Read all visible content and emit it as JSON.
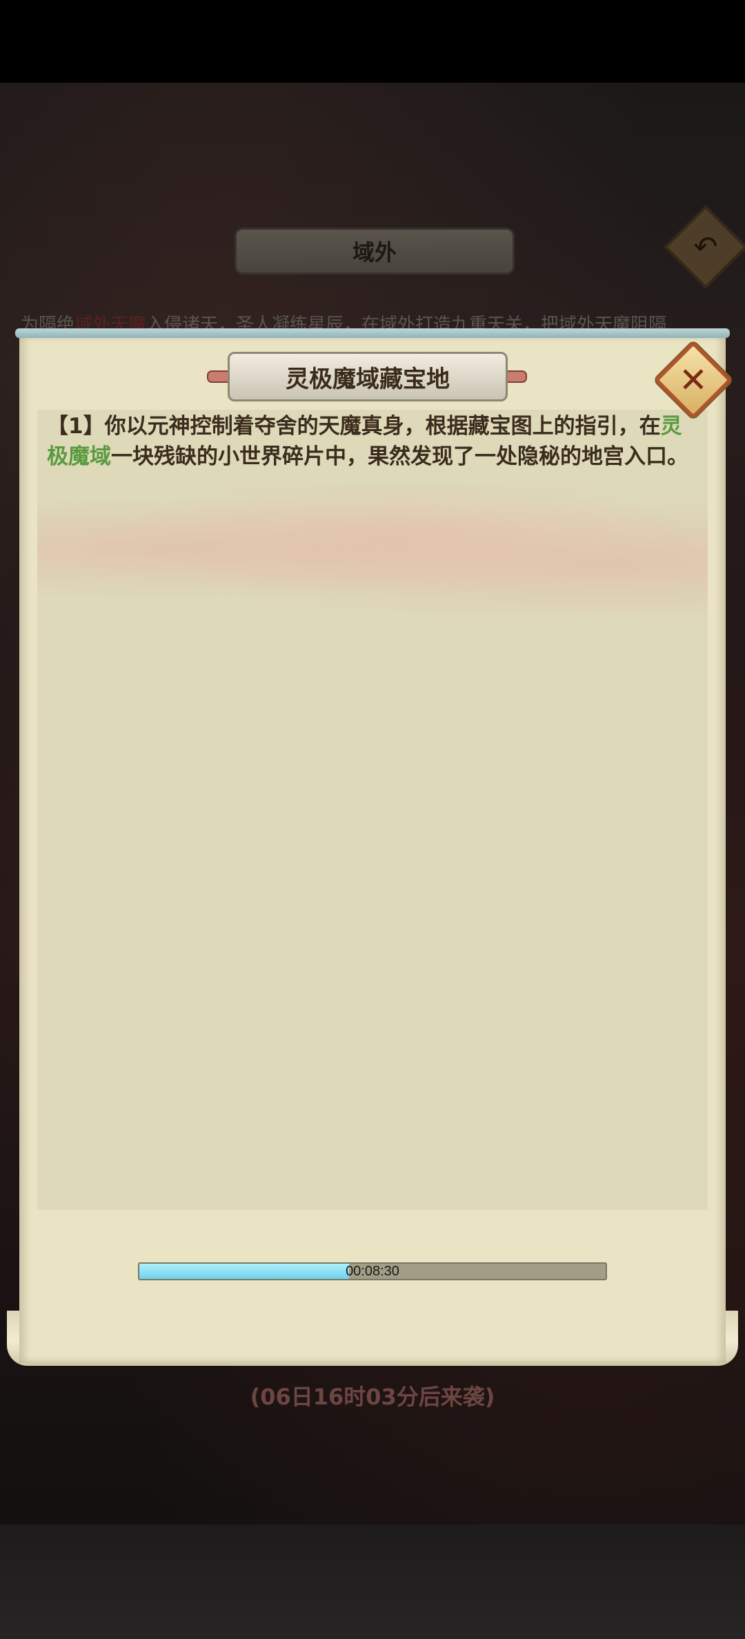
{
  "background": {
    "title": "域外",
    "back_icon": "back-arrow-icon",
    "intro_text_prefix": "为隔绝",
    "intro_text_highlight": "域外天魔",
    "intro_text_suffix": "入侵诸天，圣人凝练星辰，在域外打造九重天关，把域外天魔阻隔",
    "countdown": "(06日16时03分后来袭)"
  },
  "dialog": {
    "title": "灵极魔域藏宝地",
    "close_icon": "close-icon",
    "story": {
      "part1": "【1】你以元神控制着夺舍的天魔真身，根据藏宝图上的指引，在",
      "highlight": "灵极魔域",
      "part2": "一块残缺的小世界碎片中，果然发现了一处隐秘的地宫入口。"
    },
    "progress": {
      "label": "00:08:30",
      "fraction": 0.45
    }
  },
  "colors": {
    "highlight_green": "#5b9a3f",
    "highlight_red": "#8a3333",
    "progress_fill": "#6fd2ea"
  }
}
